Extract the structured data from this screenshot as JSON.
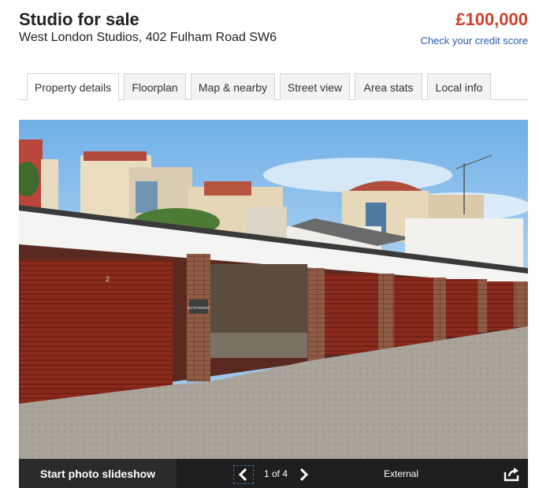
{
  "listing": {
    "title": "Studio for sale",
    "address": "West London Studios, 402 Fulham Road SW6",
    "price": "£100,000",
    "credit_link": "Check your credit score"
  },
  "tabs": [
    {
      "label": "Property details",
      "active": true
    },
    {
      "label": "Floorplan",
      "active": false
    },
    {
      "label": "Map & nearby",
      "active": false
    },
    {
      "label": "Street view",
      "active": false
    },
    {
      "label": "Area stats",
      "active": false
    },
    {
      "label": "Local info",
      "active": false
    }
  ],
  "photo": {
    "slideshow_label": "Start photo slideshow",
    "counter": "1 of 4",
    "label": "External",
    "sign_text": "NO PARKING",
    "door_number": "2"
  },
  "icons": {
    "prev": "chevron-left-icon",
    "next": "chevron-right-icon",
    "share": "share-icon"
  },
  "colors": {
    "price": "#d1402a",
    "link": "#2a5db0",
    "photo_bar": "#1e1e1e"
  }
}
